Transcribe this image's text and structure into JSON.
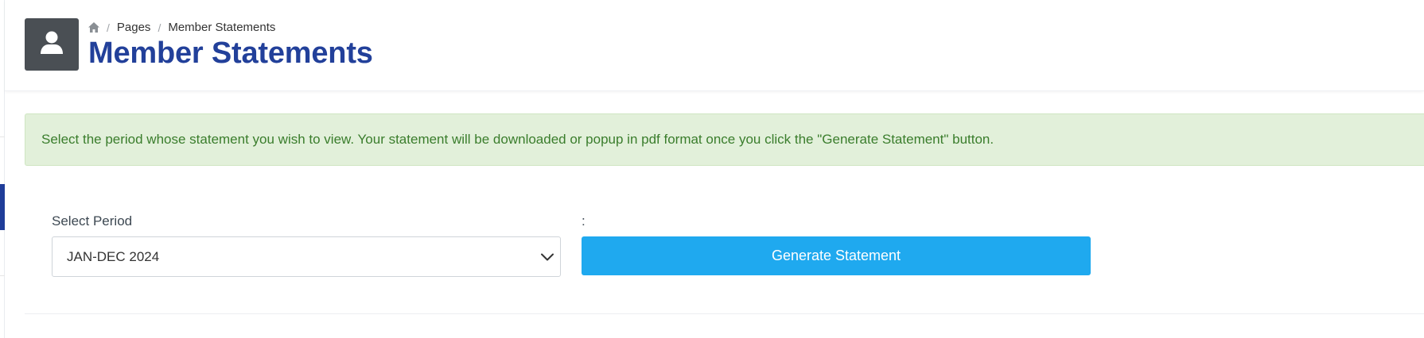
{
  "breadcrumb": {
    "home_icon": "home-icon",
    "items": [
      "Pages",
      "Member Statements"
    ],
    "separator": "/"
  },
  "header": {
    "avatar_icon": "user-icon",
    "title": "Member Statements"
  },
  "alert": {
    "text": "Select the period whose statement you wish to view. Your statement will be downloaded or popup in pdf format once you click the \"Generate Statement\" button."
  },
  "form": {
    "period_label": "Select Period",
    "period_value": "JAN-DEC 2024",
    "button_label_prefix": ":",
    "generate_label": "Generate Statement"
  },
  "colors": {
    "title": "#22409a",
    "alert_bg": "#e2f0da",
    "alert_text": "#3a7d2c",
    "button": "#1fa9ef",
    "avatar_bg": "#4a4f54",
    "sidebar_active": "#1f3d99"
  }
}
